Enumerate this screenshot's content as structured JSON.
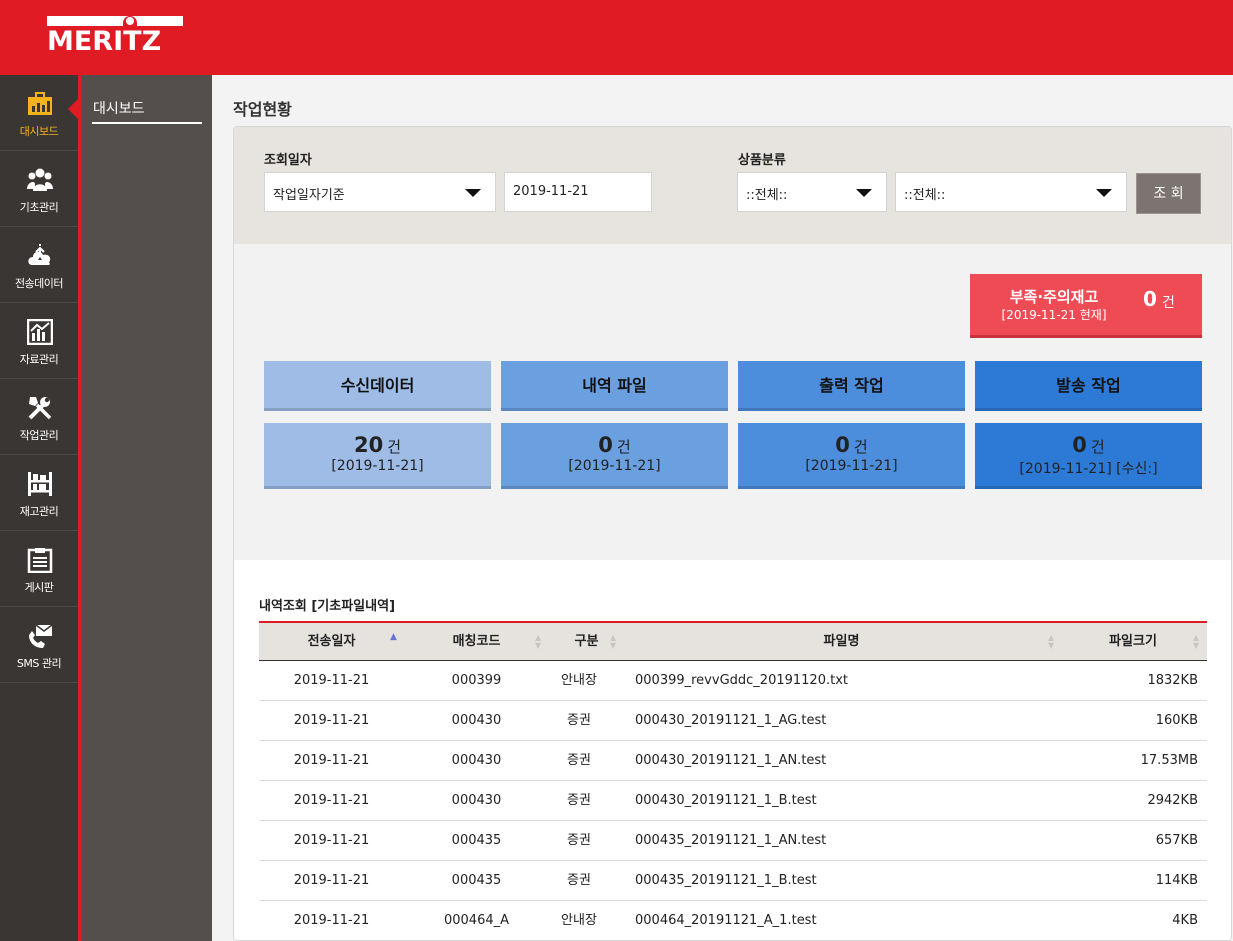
{
  "header": {
    "logo_text": "MERITZ"
  },
  "nav": [
    {
      "label": "대시보드",
      "icon": "dashboard-icon",
      "active": true
    },
    {
      "label": "기초관리",
      "icon": "users-icon"
    },
    {
      "label": "전송데이터",
      "icon": "cloud-upload-icon"
    },
    {
      "label": "자료관리",
      "icon": "chart-icon"
    },
    {
      "label": "작업관리",
      "icon": "tools-icon"
    },
    {
      "label": "재고관리",
      "icon": "shelf-icon"
    },
    {
      "label": "게시판",
      "icon": "clipboard-icon"
    },
    {
      "label": "SMS 관리",
      "icon": "sms-phone-icon"
    }
  ],
  "subnav": {
    "active_label": "대시보드"
  },
  "page": {
    "title": "작업현황"
  },
  "search": {
    "date_label": "조회일자",
    "date_type": "작업일자기준",
    "date_value": "2019-11-21",
    "product_label": "상품분류",
    "product_cat1": "::전체::",
    "product_cat2": "::전체::",
    "search_button": "조 회"
  },
  "alert": {
    "title": "부족·주의재고",
    "subtitle": "[2019-11-21 현재]",
    "count": "0",
    "unit": "건"
  },
  "cards": [
    {
      "title": "수신데이터",
      "count": "20",
      "unit": "건",
      "date": "[2019-11-21]",
      "color": "#9ebce6"
    },
    {
      "title": "내역 파일",
      "count": "0",
      "unit": "건",
      "date": "[2019-11-21]",
      "color": "#6a9fe0"
    },
    {
      "title": "출력 작업",
      "count": "0",
      "unit": "건",
      "date": "[2019-11-21]",
      "color": "#4c8ddc"
    },
    {
      "title": "발송 작업",
      "count": "0",
      "unit": "건",
      "date": "[2019-11-21] [수신:]",
      "color": "#2d7ad6"
    }
  ],
  "list": {
    "title": "내역조회 [기초파일내역]",
    "columns": [
      "전송일자",
      "매칭코드",
      "구분",
      "파일명",
      "파일크기"
    ],
    "rows": [
      [
        "2019-11-21",
        "000399",
        "안내장",
        "000399_revvGddc_20191120.txt",
        "1832KB"
      ],
      [
        "2019-11-21",
        "000430",
        "증권",
        "000430_20191121_1_AG.test",
        "160KB"
      ],
      [
        "2019-11-21",
        "000430",
        "증권",
        "000430_20191121_1_AN.test",
        "17.53MB"
      ],
      [
        "2019-11-21",
        "000430",
        "증권",
        "000430_20191121_1_B.test",
        "2942KB"
      ],
      [
        "2019-11-21",
        "000435",
        "증권",
        "000435_20191121_1_AN.test",
        "657KB"
      ],
      [
        "2019-11-21",
        "000435",
        "증권",
        "000435_20191121_1_B.test",
        "114KB"
      ],
      [
        "2019-11-21",
        "000464_A",
        "안내장",
        "000464_20191121_A_1.test",
        "4KB"
      ]
    ]
  },
  "colors": {
    "brand_red": "#e01b24",
    "nav_bg": "#3a3634",
    "subnav_bg": "#544f4c",
    "active_nav_text": "#f5b21b",
    "alert_bg": "#ef4b55",
    "search_button_bg": "#7b7470"
  }
}
